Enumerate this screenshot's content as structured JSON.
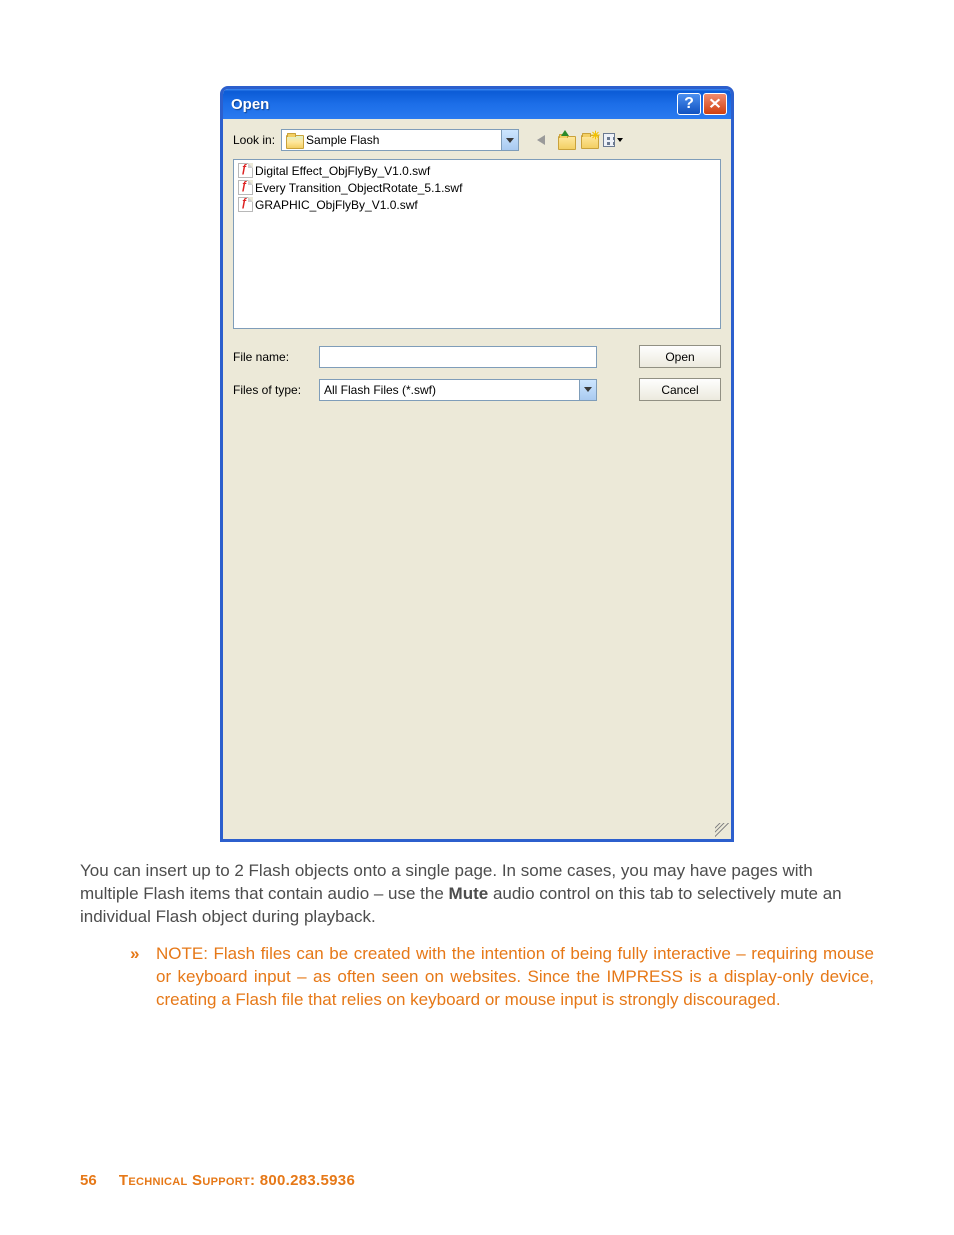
{
  "dialog": {
    "title": "Open",
    "lookInLabel": "Look in:",
    "lookInValue": "Sample Flash",
    "files": [
      "Digital Effect_ObjFlyBy_V1.0.swf",
      "Every Transition_ObjectRotate_5.1.swf",
      "GRAPHIC_ObjFlyBy_V1.0.swf"
    ],
    "fileNameLabel": "File name:",
    "fileNameValue": "",
    "filesOfTypeLabel": "Files of type:",
    "filesOfTypeValue": "All Flash Files (*.swf)",
    "openBtn": "Open",
    "cancelBtn": "Cancel"
  },
  "body": {
    "p1a": "You can insert up to 2 Flash objects onto a single page. In some cases, you may have pages with multiple Flash items that contain audio – use the ",
    "p1b": "Mute",
    "p1c": " audio control on this tab to selectively mute an individual Flash object during playback.",
    "noteMarker": "»",
    "note": "NOTE: Flash files can be created with the intention of being fully interactive – requiring mouse or keyboard input – as often seen on websites. Since the IMPRESS is a display-only device, creating a Flash file that relies on keyboard or mouse input is strongly discouraged."
  },
  "footer": {
    "page": "56",
    "supportLabel": "Technical Support: ",
    "supportPhone": "800.283.5936"
  }
}
